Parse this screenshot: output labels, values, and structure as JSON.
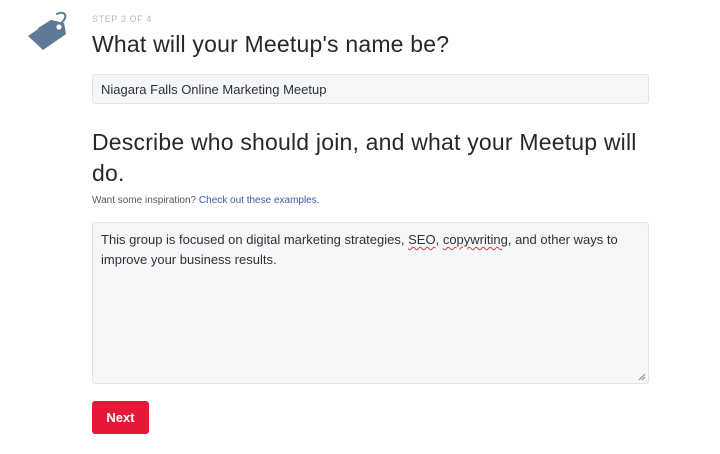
{
  "wizard": {
    "step_label": "STEP 3 OF 4",
    "title": "What will your Meetup's name be?",
    "tag_icon": "price-tag-icon"
  },
  "name_field": {
    "value": "Niagara Falls Online Marketing Meetup"
  },
  "description": {
    "heading": "Describe who should join, and what your Meetup will do.",
    "hint_prefix": "Want some inspiration? ",
    "hint_link": "Check out these examples.",
    "text_part1": "This group is focused on digital marketing strategies, ",
    "word_seo": "SEO",
    "text_part2": ", ",
    "word_copywriting": "copywriting",
    "text_part3": ", and other ways to improve your business results."
  },
  "actions": {
    "next_label": "Next"
  },
  "colors": {
    "accent": "#e51937",
    "link": "#3b5ba8",
    "tag_icon": "#5f7a97"
  }
}
